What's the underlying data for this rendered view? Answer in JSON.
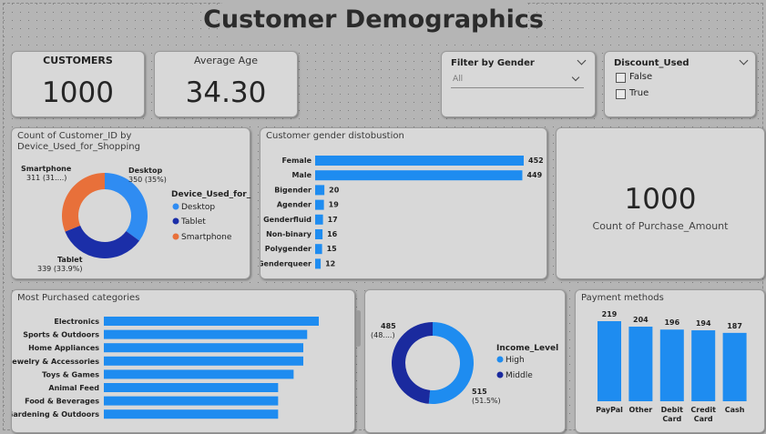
{
  "header": {
    "title": "Customer Demographics"
  },
  "kpi_customers": {
    "label": "CUSTOMERS",
    "value": "1000"
  },
  "kpi_age": {
    "label": "Average Age",
    "value": "34.30"
  },
  "filter_gender": {
    "title": "Filter by Gender",
    "selected": "All"
  },
  "filter_discount": {
    "title": "Discount_Used",
    "options": [
      "False",
      "True"
    ]
  },
  "kpi_purchase": {
    "value": "1000",
    "label": "Count of Purchase_Amount"
  },
  "colors": {
    "desktop": "#2f8cf2",
    "tablet": "#1b2ea8",
    "smartphone": "#e8703a",
    "bar": "#1e8cf0",
    "high": "#1e8cf0",
    "middle": "#1a2a9e"
  },
  "chart_data": [
    {
      "type": "pie",
      "title": "Count of Customer_ID by Device_Used_for_Shopping",
      "legend_title": "Device_Used_for_...",
      "categories": [
        "Desktop",
        "Tablet",
        "Smartphone"
      ],
      "values": [
        350,
        339,
        311
      ],
      "data_labels": [
        "350 (35%)",
        "339 (33.9%)",
        "311 (31....)"
      ]
    },
    {
      "type": "bar",
      "title": "Customer gender distobustion",
      "categories": [
        "Female",
        "Male",
        "Bigender",
        "Agender",
        "Genderfluid",
        "Non-binary",
        "Polygender",
        "Genderqueer"
      ],
      "values": [
        452,
        449,
        20,
        19,
        17,
        16,
        15,
        12
      ]
    },
    {
      "type": "bar",
      "title": "Most Purchased categories",
      "categories": [
        "Electronics",
        "Sports & Outdoors",
        "Home Appliances",
        "Jewelry & Accessories",
        "Toys & Games",
        "Animal Feed",
        "Food & Beverages",
        "Gardening & Outdoors"
      ],
      "values": [
        111,
        105,
        103,
        103,
        98,
        90,
        90,
        90
      ]
    },
    {
      "type": "pie",
      "title": "",
      "legend_title": "Income_Level",
      "categories": [
        "High",
        "Middle"
      ],
      "values": [
        515,
        485
      ],
      "data_labels": [
        "515 (51.5%)",
        "485 (48....)"
      ]
    },
    {
      "type": "bar",
      "title": "Payment methods",
      "categories": [
        "PayPal",
        "Other",
        "Debit Card",
        "Credit Card",
        "Cash"
      ],
      "values": [
        219,
        204,
        196,
        194,
        187
      ]
    }
  ]
}
